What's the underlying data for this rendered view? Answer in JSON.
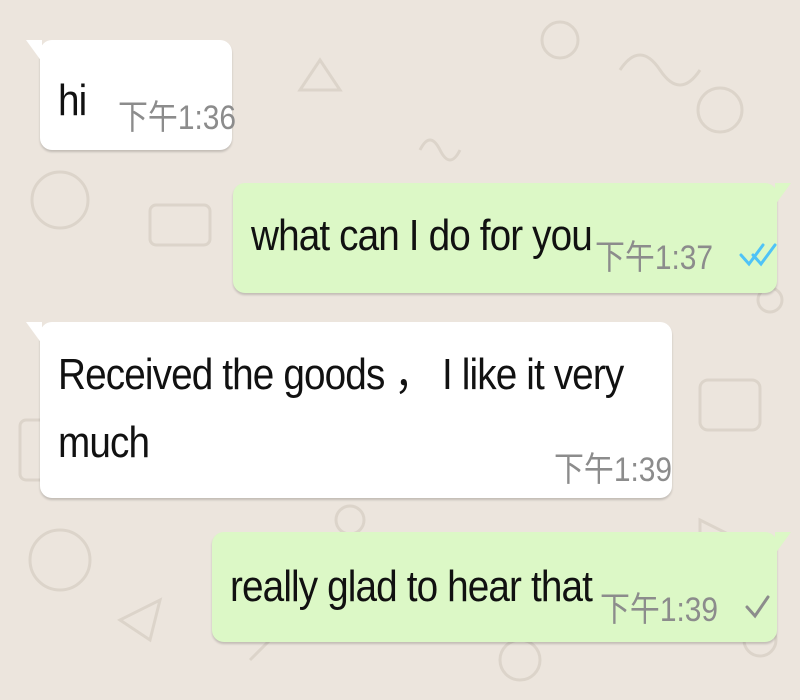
{
  "colors": {
    "wallpaper": "#ece5dd",
    "incoming_bubble": "#ffffff",
    "outgoing_bubble": "#dcf8c6",
    "meta_text": "#8c8c8c",
    "read_tick": "#4fc3f7",
    "sent_tick": "#8c8c8c"
  },
  "messages": [
    {
      "direction": "incoming",
      "text_lines": [
        "hi"
      ],
      "time": "下午1:36",
      "status": ""
    },
    {
      "direction": "outgoing",
      "text_lines": [
        "what can I do for you"
      ],
      "time": "下午1:37",
      "status": "read",
      "status_icon": "double-check-icon"
    },
    {
      "direction": "incoming",
      "text_lines": [
        "Received the goods ， I like it very",
        "much"
      ],
      "time": "下午1:39",
      "status": ""
    },
    {
      "direction": "outgoing",
      "text_lines": [
        "really glad to hear that"
      ],
      "time": "下午1:39",
      "status": "sent",
      "status_icon": "single-check-icon"
    }
  ]
}
